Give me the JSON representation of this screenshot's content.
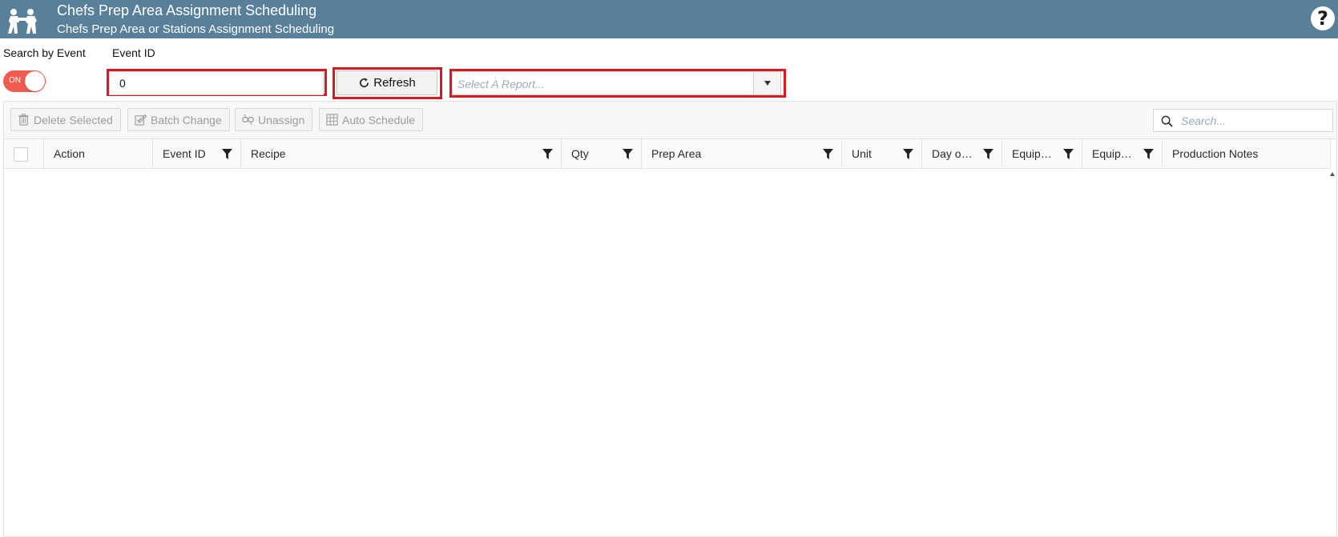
{
  "header": {
    "title": "Chefs Prep Area Assignment Scheduling",
    "subtitle": "Chefs Prep Area or Stations Assignment Scheduling",
    "help_label": "?"
  },
  "controls": {
    "search_by_event_label": "Search by Event",
    "toggle_state": "ON",
    "event_id_label": "Event ID",
    "event_id_value": "0",
    "refresh_label": "Refresh",
    "report_placeholder": "Select A Report..."
  },
  "toolbar": {
    "delete_selected": "Delete Selected",
    "batch_change": "Batch Change",
    "unassign": "Unassign",
    "auto_schedule": "Auto Schedule",
    "search_placeholder": "Search..."
  },
  "table": {
    "columns": [
      {
        "label": "Action",
        "filter": false
      },
      {
        "label": "Event ID",
        "filter": true
      },
      {
        "label": "Recipe",
        "filter": true
      },
      {
        "label": "Qty",
        "filter": true
      },
      {
        "label": "Prep Area",
        "filter": true
      },
      {
        "label": "Unit",
        "filter": true
      },
      {
        "label": "Day o…",
        "filter": true
      },
      {
        "label": "Equip…",
        "filter": true
      },
      {
        "label": "Equip…",
        "filter": true
      },
      {
        "label": "Production Notes",
        "filter": false
      }
    ],
    "rows": []
  },
  "colors": {
    "header_bg": "#58809b",
    "toggle_on": "#f25c4f",
    "highlight_border": "#d8191f"
  }
}
